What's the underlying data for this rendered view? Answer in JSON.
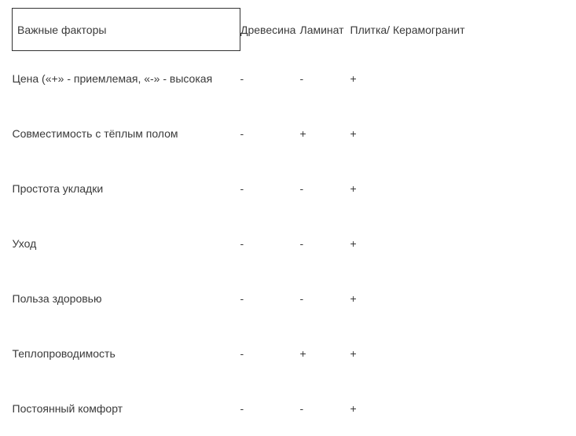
{
  "headers": {
    "factors": "Важные факторы",
    "wood": "Древесина",
    "laminate": "Ламинат",
    "tile": "Плитка/ Керамогранит"
  },
  "rows": [
    {
      "factor": "Цена («+» - приемлемая, «-» - высокая",
      "wood": "-",
      "laminate": "-",
      "tile": "+"
    },
    {
      "factor": "Совместимость с тёплым полом",
      "wood": "-",
      "laminate": "+",
      "tile": "+"
    },
    {
      "factor": "Простота укладки",
      "wood": "-",
      "laminate": "-",
      "tile": "+"
    },
    {
      "factor": "Уход",
      "wood": "-",
      "laminate": "-",
      "tile": "+"
    },
    {
      "factor": "Польза здоровью",
      "wood": "-",
      "laminate": "-",
      "tile": "+"
    },
    {
      "factor": "Теплопроводимость",
      "wood": "-",
      "laminate": "+",
      "tile": "+"
    },
    {
      "factor": "Постоянный комфорт",
      "wood": "-",
      "laminate": "-",
      "tile": "+"
    }
  ]
}
